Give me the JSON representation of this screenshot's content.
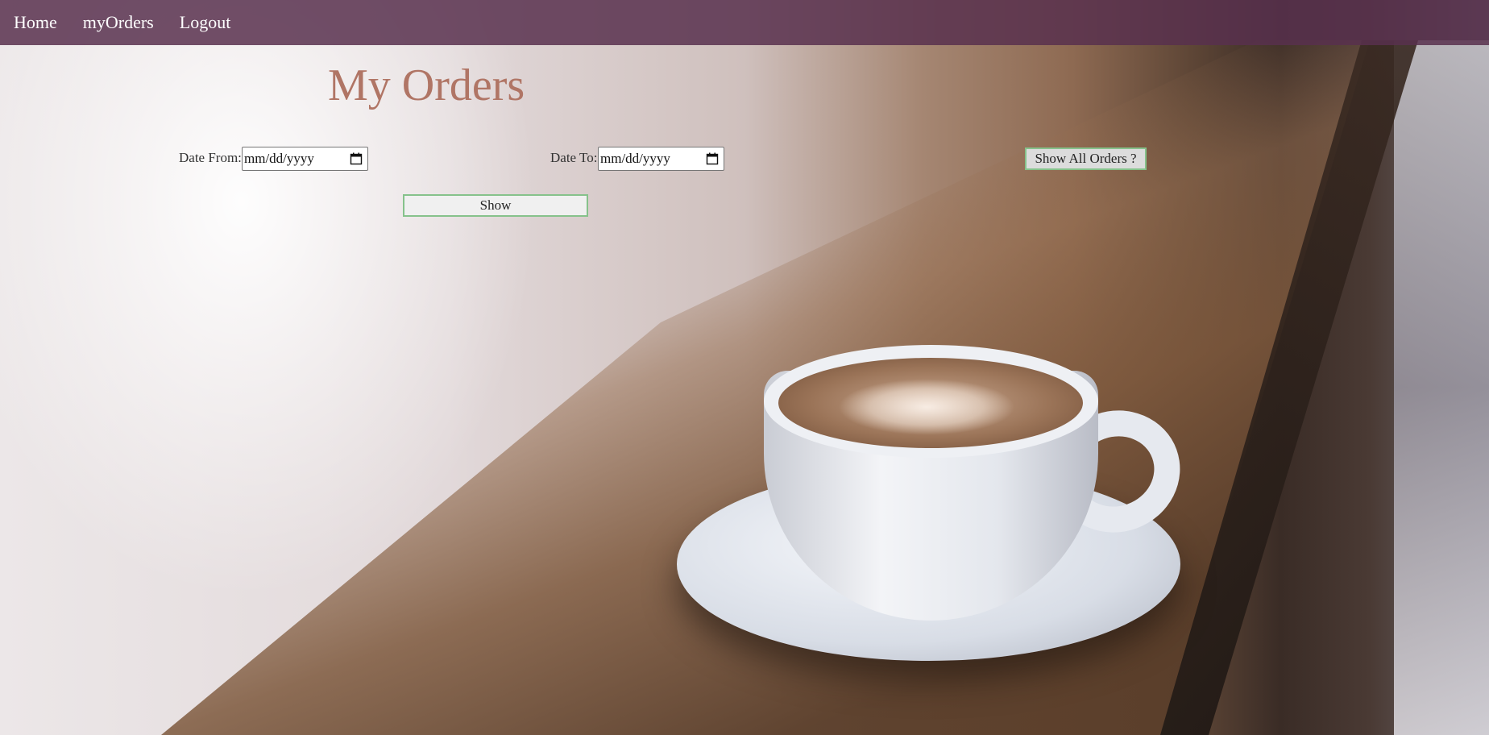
{
  "nav": {
    "items": [
      {
        "label": "Home"
      },
      {
        "label": "myOrders"
      },
      {
        "label": "Logout"
      }
    ]
  },
  "main": {
    "title": "My Orders",
    "date_from": {
      "label": "Date From:",
      "placeholder": "mm/dd/yyyy",
      "value": ""
    },
    "date_to": {
      "label": "Date To:",
      "placeholder": "mm/dd/yyyy",
      "value": ""
    },
    "show_all_label": "Show All Orders ?",
    "show_label": "Show"
  },
  "icons": {
    "date_from_icon": "calendar-icon",
    "date_to_icon": "calendar-icon"
  },
  "colors": {
    "navbar": "#58304e",
    "title": "#b07565",
    "button_border": "#86c28b"
  }
}
